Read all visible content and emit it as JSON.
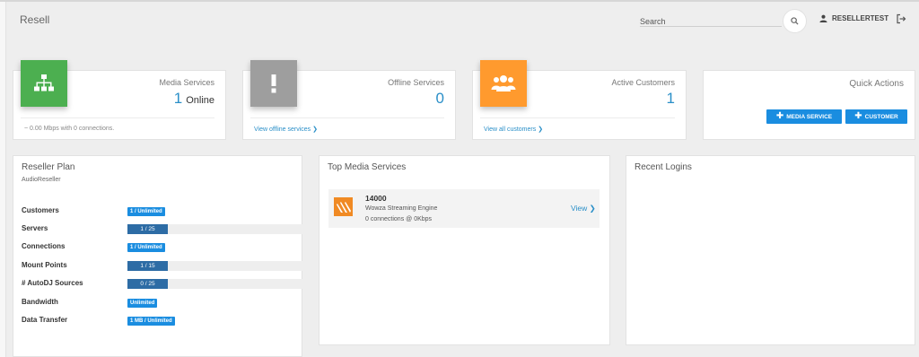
{
  "header": {
    "title": "Resell",
    "search_placeholder": "Search",
    "username": "RESELLERTEST"
  },
  "stats": {
    "media_services": {
      "label": "Media Services",
      "value": "1",
      "suffix": "Online",
      "footer": "~ 0.00 Mbps with 0 connections."
    },
    "offline_services": {
      "label": "Offline Services",
      "value": "0",
      "link": "View offline services"
    },
    "active_customers": {
      "label": "Active Customers",
      "value": "1",
      "link": "View all customers"
    }
  },
  "quick_actions": {
    "title": "Quick Actions",
    "media_service_label": "MEDIA SERVICE",
    "customer_label": "CUSTOMER"
  },
  "reseller_plan": {
    "title": "Reseller Plan",
    "plan_name": "AudioReseller",
    "rows": [
      {
        "label": "Customers",
        "value": "1 / Unlimited",
        "kind": "badge"
      },
      {
        "label": "Servers",
        "value": "1 / 25",
        "kind": "bar",
        "fraction": 0.04
      },
      {
        "label": "Connections",
        "value": "1 / Unlimited",
        "kind": "badge"
      },
      {
        "label": "Mount Points",
        "value": "1 / 15",
        "kind": "bar",
        "fraction": 0.067
      },
      {
        "label": "# AutoDJ Sources",
        "value": "0 / 25",
        "kind": "bar",
        "fraction": 0
      },
      {
        "label": "Bandwidth",
        "value": "Unlimited",
        "kind": "badge"
      },
      {
        "label": "Data Transfer",
        "value": "1 MB / Unlimited",
        "kind": "badge"
      }
    ]
  },
  "top_media_services": {
    "title": "Top Media Services",
    "items": [
      {
        "name": "14000",
        "engine": "Wowza Streaming Engine",
        "connections": "0 connections @ 0Kbps",
        "view_label": "View"
      }
    ]
  },
  "recent_logins": {
    "title": "Recent Logins"
  },
  "colors": {
    "green": "#4caf50",
    "gray": "#9e9e9e",
    "orange": "#ff9a2e",
    "blue": "#1a8de0",
    "bar": "#2d6ca5",
    "link": "#2a8fc8"
  }
}
